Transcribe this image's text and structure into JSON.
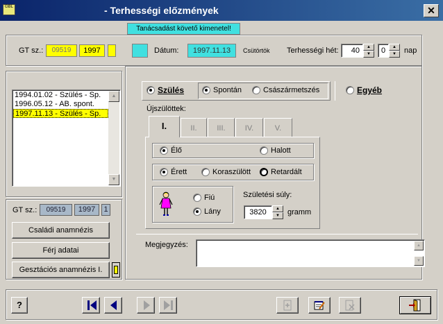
{
  "window": {
    "title": "- Terhességi előzmények",
    "icon_label": "GBL",
    "close_label": "✕"
  },
  "header": {
    "notice": "Tanácsadást követő kimenetel!",
    "gt_label": "GT sz.:",
    "gt_number": "09519",
    "gt_year": "1997",
    "date_label": "Dátum:",
    "date_value": "1997.11.13",
    "weekday": "Csütörtök",
    "week_label": "Terhességi hét:",
    "week_value": "40",
    "days_value": "0",
    "days_label": "nap"
  },
  "history_list": {
    "items": [
      {
        "label": "1994.01.02 - Szülés - Sp."
      },
      {
        "label": "1996.05.12 - AB. spont."
      },
      {
        "label": "1997.11.13 - Szülés - Sp."
      }
    ],
    "selected_index": 2
  },
  "left_panel": {
    "gt_label": "GT sz.:",
    "gt_number": "09519",
    "gt_year": "1997",
    "gt_count": "1",
    "family_button": "Családi anamnézis",
    "husband_button": "Férj adatai",
    "gest_button": "Gesztációs anamnézis I."
  },
  "outcome": {
    "birth_label": "Szülés",
    "spontaneous_label": "Spontán",
    "cesarean_label": "Császármetszés",
    "other_label": "Egyéb",
    "birth_selected": true,
    "spontaneous_selected": true
  },
  "newborns": {
    "label": "Újszülöttek:",
    "tabs": [
      {
        "label": "I."
      },
      {
        "label": "II."
      },
      {
        "label": "III."
      },
      {
        "label": "IV."
      },
      {
        "label": "V."
      }
    ],
    "active_tab": 0,
    "alive_label": "Élő",
    "dead_label": "Halott",
    "alive_selected": true,
    "mature_label": "Érett",
    "premature_label": "Koraszülött",
    "retarded_label": "Retardált",
    "mature_selected": true,
    "boy_label": "Fiú",
    "girl_label": "Lány",
    "girl_selected": true,
    "weight_label": "Születési súly:",
    "weight_value": "3820",
    "weight_unit": "gramm"
  },
  "notes": {
    "label": "Megjegyzés:",
    "value": ""
  },
  "toolbar": {
    "help_label": "?"
  },
  "colors": {
    "title_start": "#0a246a",
    "title_end": "#3a6ea5",
    "cyan": "#40e0e0",
    "yellow": "#ffff00",
    "selection": "#ffff00"
  }
}
